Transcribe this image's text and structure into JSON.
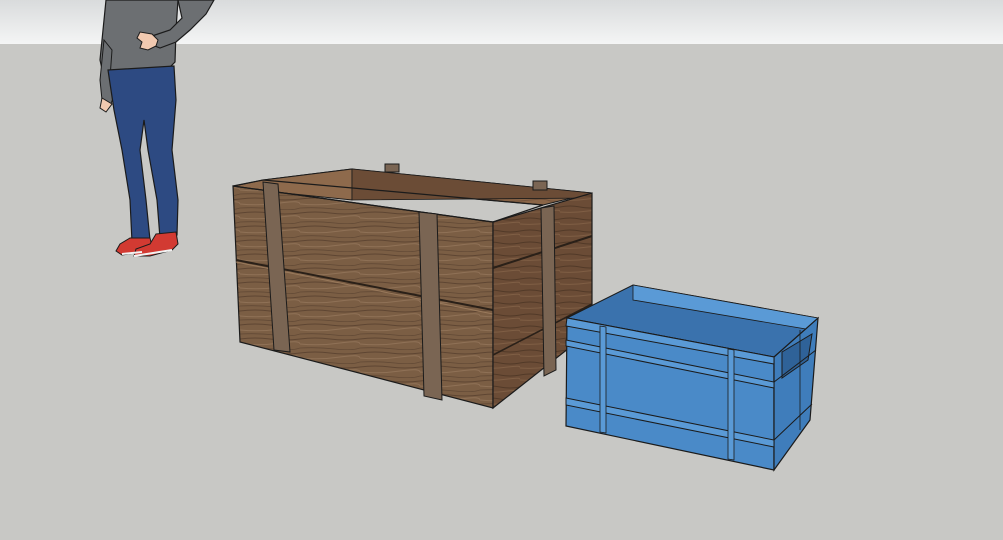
{
  "app": {
    "view": "3d-modeling-viewport",
    "colors": {
      "sky_top": "#d9dbdc",
      "sky_bottom": "#f4f5f5",
      "ground": "#c8c8c5",
      "wood_light": "#8a6a4c",
      "wood_dark": "#5b4330",
      "wood_strap": "#7a6553",
      "crate_blue": "#4a8ac8",
      "crate_blue_dark": "#3a72ad",
      "crate_blue_light": "#5a9ad6",
      "shirt": "#6c6f72",
      "jeans": "#2d4a82",
      "sneaker": "#d23a32",
      "skin": "#f1c9b0",
      "outline": "#1b1b1b"
    }
  },
  "scene": {
    "objects": [
      {
        "name": "scale-figure",
        "label": ""
      },
      {
        "name": "wooden-crate",
        "label": ""
      },
      {
        "name": "blue-plastic-crate",
        "label": ""
      }
    ]
  }
}
